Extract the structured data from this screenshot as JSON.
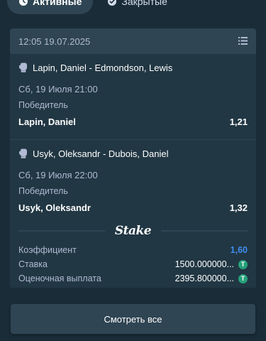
{
  "tabs": [
    {
      "label": "Активные",
      "icon": "clock-icon",
      "active": true
    },
    {
      "label": "Закрытые",
      "icon": "check-circle-icon",
      "active": false
    }
  ],
  "bet": {
    "timestamp": "12:05 19.07.2025",
    "menu_icon": "list-icon",
    "legs": [
      {
        "sport_icon": "boxing-glove-icon",
        "event": "Lapin, Daniel - Edmondson, Lewis",
        "date": "Сб, 19 Июля 21:00",
        "market": "Победитель",
        "selection": "Lapin, Daniel",
        "odds": "1,21"
      },
      {
        "sport_icon": "boxing-glove-icon",
        "event": "Usyk, Oleksandr - Dubois, Daniel",
        "date": "Сб, 19 Июля 22:00",
        "market": "Победитель",
        "selection": "Usyk, Oleksandr",
        "odds": "1,32"
      }
    ],
    "brand": "Stake",
    "summary": {
      "odds_label": "Коэффициент",
      "odds_value": "1,60",
      "stake_label": "Ставка",
      "stake_value": "1500.000000...",
      "payout_label": "Оценочная выплата",
      "payout_value": "2395.800000...",
      "currency_icon": "tether-icon",
      "currency_glyph": "T"
    }
  },
  "see_all_label": "Смотреть все",
  "colors": {
    "background": "#1a2c38",
    "card": "#213743",
    "card_header": "#2f4553",
    "accent_odds": "#3f8ef0",
    "tether": "#26a17b"
  }
}
